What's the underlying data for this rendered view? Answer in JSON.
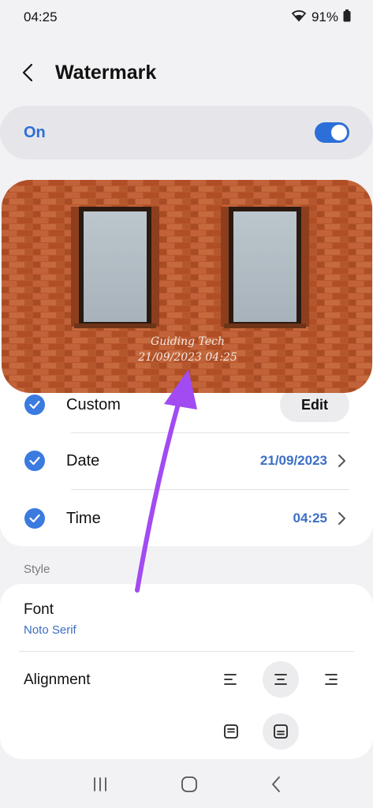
{
  "status_bar": {
    "time": "04:25",
    "battery": "91%"
  },
  "header": {
    "title": "Watermark"
  },
  "toggle": {
    "label": "On",
    "state": "on",
    "color": "#2d6fd8"
  },
  "photo": {
    "watermark_line1": "Guiding Tech",
    "watermark_line2": "21/09/2023 04:25"
  },
  "options": {
    "custom": {
      "label": "Custom",
      "button": "Edit",
      "checked": true
    },
    "date": {
      "label": "Date",
      "value": "21/09/2023",
      "checked": true
    },
    "time": {
      "label": "Time",
      "value": "04:25",
      "checked": true
    }
  },
  "style": {
    "section_label": "Style",
    "font_title": "Font",
    "font_value": "Noto Serif",
    "alignment_label": "Alignment",
    "alignment_selected": "center",
    "position_selected": "bottom"
  },
  "annotation": {
    "arrow_color": "#a24bf2"
  },
  "icons": {
    "back": "chevron-left-icon",
    "wifi": "wifi-icon",
    "battery": "battery-icon",
    "check": "check-icon",
    "chevron": "chevron-right-icon",
    "align_left": "align-left-icon",
    "align_center": "align-center-icon",
    "align_right": "align-right-icon",
    "position_top": "position-top-icon",
    "position_bottom": "position-bottom-icon",
    "recents": "recents-icon",
    "home": "home-icon",
    "back_nav": "back-nav-icon"
  }
}
